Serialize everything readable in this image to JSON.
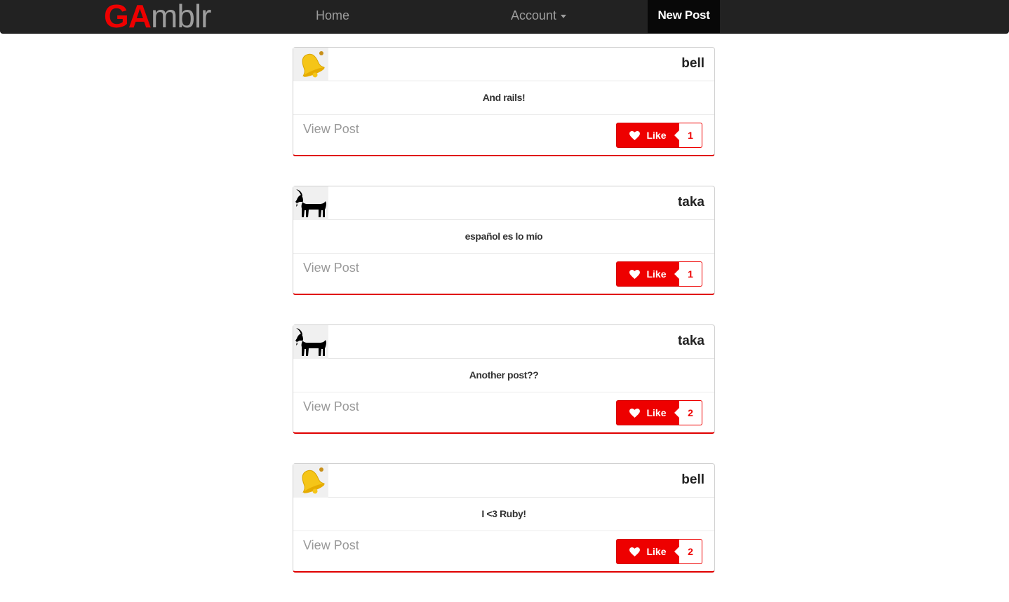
{
  "nav": {
    "brand_part1": "GA",
    "brand_part2": "mblr",
    "home": "Home",
    "account": "Account",
    "new_post": "New Post"
  },
  "posts": [
    {
      "author": "bell",
      "avatar": "bell-icon",
      "body": "And rails!",
      "view_label": "View Post",
      "like_label": "Like",
      "likes": "1"
    },
    {
      "author": "taka",
      "avatar": "goat-icon",
      "body": "español es lo mío",
      "view_label": "View Post",
      "like_label": "Like",
      "likes": "1"
    },
    {
      "author": "taka",
      "avatar": "goat-icon",
      "body": "Another post??",
      "view_label": "View Post",
      "like_label": "Like",
      "likes": "2"
    },
    {
      "author": "bell",
      "avatar": "bell-icon",
      "body": "I <3 Ruby!",
      "view_label": "View Post",
      "like_label": "Like",
      "likes": "2"
    }
  ],
  "colors": {
    "accent": "#ee0000",
    "navbar": "#222222",
    "nav_text": "#9d9d9d"
  }
}
